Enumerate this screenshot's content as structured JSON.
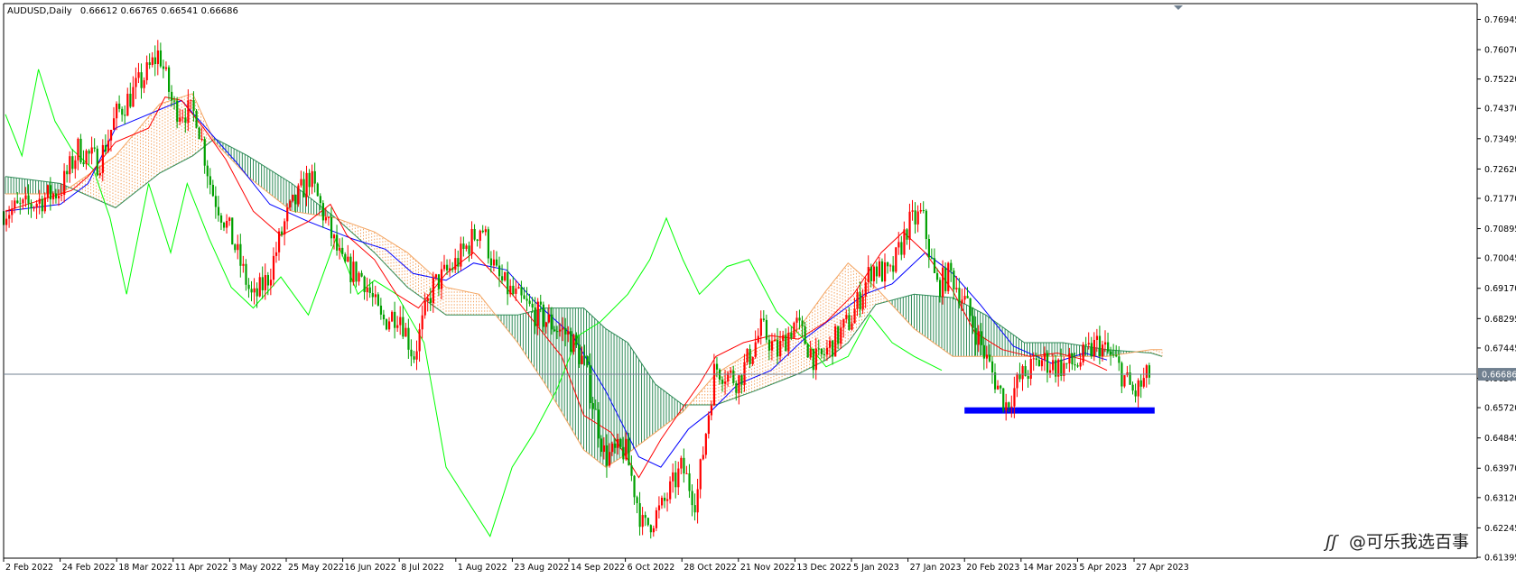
{
  "header": {
    "symbol_timeframe": "AUDUSD,Daily",
    "ohlc_readout": "0.66612 0.66765 0.66541 0.66686"
  },
  "watermark": "@可乐我选百事",
  "colors": {
    "bull_candle": "#ff0000",
    "bear_candle": "#00a000",
    "tenkan": "#ff0000",
    "kijun": "#0000ff",
    "chikou": "#00ff00",
    "cloud_bull": "#2e8b57",
    "cloud_bear": "#f4a460",
    "support_zone": "#0000ff",
    "current_price_line": "#708090",
    "axis": "#000000",
    "price_marker_bg": "#708090"
  },
  "chart_data": {
    "type": "candlestick",
    "symbol": "AUDUSD",
    "timeframe": "Daily",
    "last_bar": {
      "open": 0.66612,
      "high": 0.66765,
      "low": 0.66541,
      "close": 0.66686
    },
    "current_price_label": "0.66686",
    "current_price": 0.66686,
    "y_axis": {
      "position": "right",
      "range": [
        0.6137,
        0.774
      ],
      "ticks": [
        "0.76945",
        "0.76070",
        "0.75220",
        "0.74370",
        "0.73495",
        "0.72620",
        "0.71770",
        "0.70895",
        "0.70045",
        "0.69170",
        "0.68295",
        "0.67445",
        "0.66570",
        "0.65720",
        "0.64845",
        "0.63970",
        "0.63120",
        "0.62245",
        "0.61395"
      ]
    },
    "x_axis": {
      "position": "bottom",
      "ticks": [
        "2 Feb 2022",
        "24 Feb 2022",
        "18 Mar 2022",
        "11 Apr 2022",
        "3 May 2022",
        "25 May 2022",
        "16 Jun 2022",
        "8 Jul 2022",
        "1 Aug 2022",
        "23 Aug 2022",
        "14 Sep 2022",
        "6 Oct 2022",
        "28 Oct 2022",
        "21 Nov 2022",
        "13 Dec 2022",
        "5 Jan 2023",
        "27 Jan 2023",
        "20 Feb 2023",
        "14 Mar 2023",
        "5 Apr 2023",
        "27 Apr 2023"
      ]
    },
    "close_path": [
      {
        "date": "2 Feb 2022",
        "price": 0.714
      },
      {
        "date": "10 Feb 2022",
        "price": 0.715
      },
      {
        "date": "24 Feb 2022",
        "price": 0.72
      },
      {
        "date": "3 Mar 2022",
        "price": 0.732
      },
      {
        "date": "11 Mar 2022",
        "price": 0.728
      },
      {
        "date": "18 Mar 2022",
        "price": 0.742
      },
      {
        "date": "30 Mar 2022",
        "price": 0.753
      },
      {
        "date": "5 Apr 2022",
        "price": 0.76
      },
      {
        "date": "11 Apr 2022",
        "price": 0.744
      },
      {
        "date": "20 Apr 2022",
        "price": 0.742
      },
      {
        "date": "26 Apr 2022",
        "price": 0.72
      },
      {
        "date": "3 May 2022",
        "price": 0.708
      },
      {
        "date": "12 May 2022",
        "price": 0.688
      },
      {
        "date": "18 May 2022",
        "price": 0.695
      },
      {
        "date": "25 May 2022",
        "price": 0.712
      },
      {
        "date": "3 Jun 2022",
        "price": 0.724
      },
      {
        "date": "10 Jun 2022",
        "price": 0.71
      },
      {
        "date": "16 Jun 2022",
        "price": 0.698
      },
      {
        "date": "24 Jun 2022",
        "price": 0.695
      },
      {
        "date": "1 Jul 2022",
        "price": 0.682
      },
      {
        "date": "8 Jul 2022",
        "price": 0.685
      },
      {
        "date": "14 Jul 2022",
        "price": 0.672
      },
      {
        "date": "22 Jul 2022",
        "price": 0.692
      },
      {
        "date": "1 Aug 2022",
        "price": 0.699
      },
      {
        "date": "11 Aug 2022",
        "price": 0.71
      },
      {
        "date": "17 Aug 2022",
        "price": 0.695
      },
      {
        "date": "23 Aug 2022",
        "price": 0.69
      },
      {
        "date": "31 Aug 2022",
        "price": 0.685
      },
      {
        "date": "14 Sep 2022",
        "price": 0.678
      },
      {
        "date": "20 Sep 2022",
        "price": 0.67
      },
      {
        "date": "28 Sep 2022",
        "price": 0.643
      },
      {
        "date": "6 Oct 2022",
        "price": 0.645
      },
      {
        "date": "13 Oct 2022",
        "price": 0.622
      },
      {
        "date": "20 Oct 2022",
        "price": 0.628
      },
      {
        "date": "28 Oct 2022",
        "price": 0.64
      },
      {
        "date": "3 Nov 2022",
        "price": 0.63
      },
      {
        "date": "11 Nov 2022",
        "price": 0.669
      },
      {
        "date": "21 Nov 2022",
        "price": 0.665
      },
      {
        "date": "30 Nov 2022",
        "price": 0.68
      },
      {
        "date": "6 Dec 2022",
        "price": 0.673
      },
      {
        "date": "13 Dec 2022",
        "price": 0.682
      },
      {
        "date": "22 Dec 2022",
        "price": 0.67
      },
      {
        "date": "5 Jan 2023",
        "price": 0.683
      },
      {
        "date": "13 Jan 2023",
        "price": 0.698
      },
      {
        "date": "20 Jan 2023",
        "price": 0.695
      },
      {
        "date": "27 Jan 2023",
        "price": 0.71
      },
      {
        "date": "2 Feb 2023",
        "price": 0.713
      },
      {
        "date": "8 Feb 2023",
        "price": 0.692
      },
      {
        "date": "14 Feb 2023",
        "price": 0.696
      },
      {
        "date": "20 Feb 2023",
        "price": 0.688
      },
      {
        "date": "28 Feb 2023",
        "price": 0.672
      },
      {
        "date": "8 Mar 2023",
        "price": 0.658
      },
      {
        "date": "14 Mar 2023",
        "price": 0.666
      },
      {
        "date": "22 Mar 2023",
        "price": 0.671
      },
      {
        "date": "28 Mar 2023",
        "price": 0.669
      },
      {
        "date": "5 Apr 2023",
        "price": 0.67
      },
      {
        "date": "13 Apr 2023",
        "price": 0.676
      },
      {
        "date": "20 Apr 2023",
        "price": 0.67
      },
      {
        "date": "27 Apr 2023",
        "price": 0.661
      },
      {
        "date": "3 May 2023",
        "price": 0.6669
      }
    ],
    "support_zone": {
      "date_from": "20 Feb 2023",
      "date_to": "5 May 2023",
      "price_low": 0.6555,
      "price_high": 0.6573
    },
    "indicators": {
      "tenkan": [
        [
          0,
          0.714
        ],
        [
          12,
          0.717
        ],
        [
          24,
          0.72
        ],
        [
          30,
          0.724
        ],
        [
          40,
          0.734
        ],
        [
          52,
          0.738
        ],
        [
          58,
          0.747
        ],
        [
          64,
          0.746
        ],
        [
          72,
          0.738
        ],
        [
          80,
          0.729
        ],
        [
          90,
          0.714
        ],
        [
          100,
          0.707
        ],
        [
          110,
          0.711
        ],
        [
          118,
          0.716
        ],
        [
          124,
          0.707
        ],
        [
          134,
          0.7
        ],
        [
          142,
          0.69
        ],
        [
          150,
          0.686
        ],
        [
          160,
          0.696
        ],
        [
          170,
          0.702
        ],
        [
          176,
          0.697
        ],
        [
          184,
          0.69
        ],
        [
          192,
          0.682
        ],
        [
          202,
          0.672
        ],
        [
          210,
          0.655
        ],
        [
          220,
          0.65
        ],
        [
          230,
          0.637
        ],
        [
          238,
          0.648
        ],
        [
          244,
          0.655
        ],
        [
          252,
          0.664
        ],
        [
          258,
          0.672
        ],
        [
          268,
          0.676
        ],
        [
          278,
          0.678
        ],
        [
          288,
          0.677
        ],
        [
          298,
          0.682
        ],
        [
          308,
          0.69
        ],
        [
          318,
          0.702
        ],
        [
          326,
          0.708
        ],
        [
          334,
          0.702
        ],
        [
          344,
          0.691
        ],
        [
          352,
          0.679
        ],
        [
          362,
          0.674
        ],
        [
          372,
          0.672
        ],
        [
          382,
          0.673
        ],
        [
          392,
          0.671
        ],
        [
          400,
          0.668
        ]
      ],
      "kijun": [
        [
          0,
          0.714
        ],
        [
          20,
          0.716
        ],
        [
          30,
          0.722
        ],
        [
          40,
          0.738
        ],
        [
          64,
          0.746
        ],
        [
          74,
          0.737
        ],
        [
          84,
          0.728
        ],
        [
          96,
          0.716
        ],
        [
          110,
          0.711
        ],
        [
          126,
          0.706
        ],
        [
          138,
          0.703
        ],
        [
          148,
          0.696
        ],
        [
          160,
          0.694
        ],
        [
          170,
          0.699
        ],
        [
          182,
          0.697
        ],
        [
          192,
          0.688
        ],
        [
          206,
          0.678
        ],
        [
          218,
          0.662
        ],
        [
          230,
          0.643
        ],
        [
          238,
          0.64
        ],
        [
          248,
          0.651
        ],
        [
          256,
          0.656
        ],
        [
          266,
          0.664
        ],
        [
          278,
          0.668
        ],
        [
          290,
          0.677
        ],
        [
          300,
          0.683
        ],
        [
          312,
          0.69
        ],
        [
          322,
          0.693
        ],
        [
          334,
          0.702
        ],
        [
          344,
          0.696
        ],
        [
          354,
          0.687
        ],
        [
          366,
          0.675
        ],
        [
          380,
          0.67
        ],
        [
          392,
          0.673
        ],
        [
          400,
          0.671
        ]
      ],
      "chikou": [
        [
          0,
          0.742
        ],
        [
          6,
          0.73
        ],
        [
          12,
          0.755
        ],
        [
          18,
          0.74
        ],
        [
          24,
          0.732
        ],
        [
          32,
          0.726
        ],
        [
          38,
          0.712
        ],
        [
          44,
          0.69
        ],
        [
          52,
          0.722
        ],
        [
          60,
          0.702
        ],
        [
          66,
          0.722
        ],
        [
          74,
          0.706
        ],
        [
          82,
          0.692
        ],
        [
          90,
          0.686
        ],
        [
          100,
          0.695
        ],
        [
          110,
          0.684
        ],
        [
          120,
          0.706
        ],
        [
          128,
          0.69
        ],
        [
          134,
          0.694
        ],
        [
          142,
          0.69
        ],
        [
          152,
          0.676
        ],
        [
          160,
          0.64
        ],
        [
          168,
          0.63
        ],
        [
          176,
          0.62
        ],
        [
          184,
          0.64
        ],
        [
          192,
          0.65
        ],
        [
          200,
          0.662
        ],
        [
          208,
          0.678
        ],
        [
          216,
          0.682
        ],
        [
          226,
          0.69
        ],
        [
          234,
          0.7
        ],
        [
          240,
          0.712
        ],
        [
          246,
          0.7
        ],
        [
          252,
          0.69
        ],
        [
          262,
          0.698
        ],
        [
          270,
          0.7
        ],
        [
          280,
          0.685
        ],
        [
          290,
          0.677
        ],
        [
          298,
          0.669
        ],
        [
          306,
          0.672
        ],
        [
          314,
          0.684
        ],
        [
          322,
          0.676
        ],
        [
          330,
          0.672
        ],
        [
          340,
          0.668
        ]
      ],
      "cloud": [
        [
          0,
          0.724,
          0.719
        ],
        [
          20,
          0.722,
          0.719
        ],
        [
          40,
          0.715,
          0.73
        ],
        [
          56,
          0.725,
          0.745
        ],
        [
          68,
          0.73,
          0.748
        ],
        [
          76,
          0.735,
          0.734
        ],
        [
          88,
          0.73,
          0.724
        ],
        [
          104,
          0.722,
          0.714
        ],
        [
          120,
          0.712,
          0.712
        ],
        [
          134,
          0.702,
          0.708
        ],
        [
          146,
          0.692,
          0.702
        ],
        [
          160,
          0.684,
          0.692
        ],
        [
          172,
          0.684,
          0.69
        ],
        [
          186,
          0.684,
          0.676
        ],
        [
          196,
          0.686,
          0.664
        ],
        [
          210,
          0.686,
          0.645
        ],
        [
          218,
          0.68,
          0.64
        ],
        [
          226,
          0.676,
          0.644
        ],
        [
          236,
          0.664,
          0.65
        ],
        [
          246,
          0.658,
          0.656
        ],
        [
          258,
          0.658,
          0.667
        ],
        [
          272,
          0.662,
          0.674
        ],
        [
          288,
          0.667,
          0.68
        ],
        [
          298,
          0.671,
          0.691
        ],
        [
          306,
          0.676,
          0.699
        ],
        [
          316,
          0.687,
          0.692
        ],
        [
          330,
          0.69,
          0.68
        ],
        [
          344,
          0.689,
          0.672
        ],
        [
          356,
          0.684,
          0.672
        ],
        [
          370,
          0.676,
          0.672
        ],
        [
          384,
          0.676,
          0.672
        ],
        [
          400,
          0.674,
          0.672
        ],
        [
          416,
          0.673,
          0.674
        ],
        [
          420,
          0.672,
          0.674
        ]
      ]
    }
  }
}
